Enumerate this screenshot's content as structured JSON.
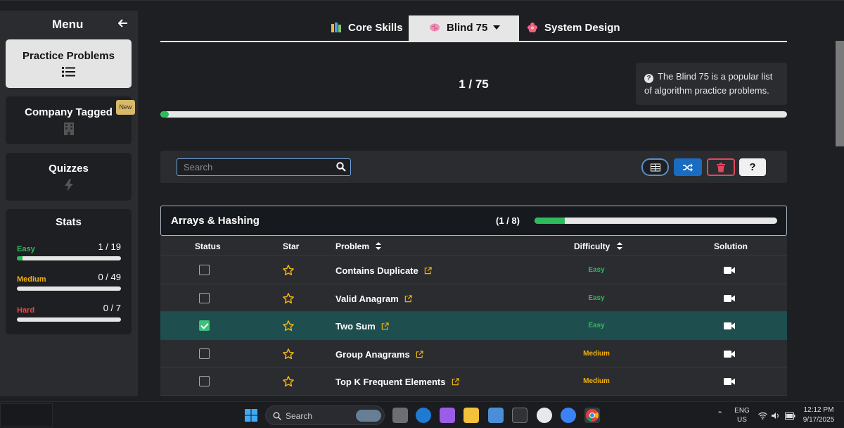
{
  "sidebar": {
    "title": "Menu",
    "items": [
      {
        "label": "Practice Problems"
      },
      {
        "label": "Company Tagged",
        "badge": "New"
      },
      {
        "label": "Quizzes"
      }
    ],
    "stats": {
      "title": "Stats",
      "rows": [
        {
          "name": "Easy",
          "value": "1 / 19",
          "fraction": 0.053,
          "color": "#2cbb5d"
        },
        {
          "name": "Medium",
          "value": "0 / 49",
          "fraction": 0,
          "color": "#f1b20d"
        },
        {
          "name": "Hard",
          "value": "0 / 7",
          "fraction": 0,
          "color": "#ef4743"
        }
      ]
    }
  },
  "tabs": [
    {
      "label": "Core Skills",
      "icon": "books-icon"
    },
    {
      "label": "Blind 75",
      "icon": "brain-icon",
      "active": true
    },
    {
      "label": "System Design",
      "icon": "flower-icon"
    }
  ],
  "progress": {
    "text": "1 / 75",
    "fraction": 0.0133
  },
  "info": {
    "text": "The Blind 75 is a popular list of algorithm practice problems."
  },
  "toolbar": {
    "search_placeholder": "Search",
    "help_label": "?"
  },
  "section": {
    "title": "Arrays & Hashing",
    "count": "(1 / 8)",
    "fraction": 0.125
  },
  "table": {
    "headers": {
      "status": "Status",
      "star": "Star",
      "problem": "Problem",
      "difficulty": "Difficulty",
      "solution": "Solution"
    },
    "rows": [
      {
        "name": "Contains Duplicate",
        "difficulty": "Easy",
        "solved": false
      },
      {
        "name": "Valid Anagram",
        "difficulty": "Easy",
        "solved": false
      },
      {
        "name": "Two Sum",
        "difficulty": "Easy",
        "solved": true
      },
      {
        "name": "Group Anagrams",
        "difficulty": "Medium",
        "solved": false
      },
      {
        "name": "Top K Frequent Elements",
        "difficulty": "Medium",
        "solved": false
      }
    ]
  },
  "taskbar": {
    "search_label": "Search",
    "lang_top": "ENG",
    "lang_bottom": "US",
    "time": "12:12 PM",
    "date": "9/17/2025"
  }
}
